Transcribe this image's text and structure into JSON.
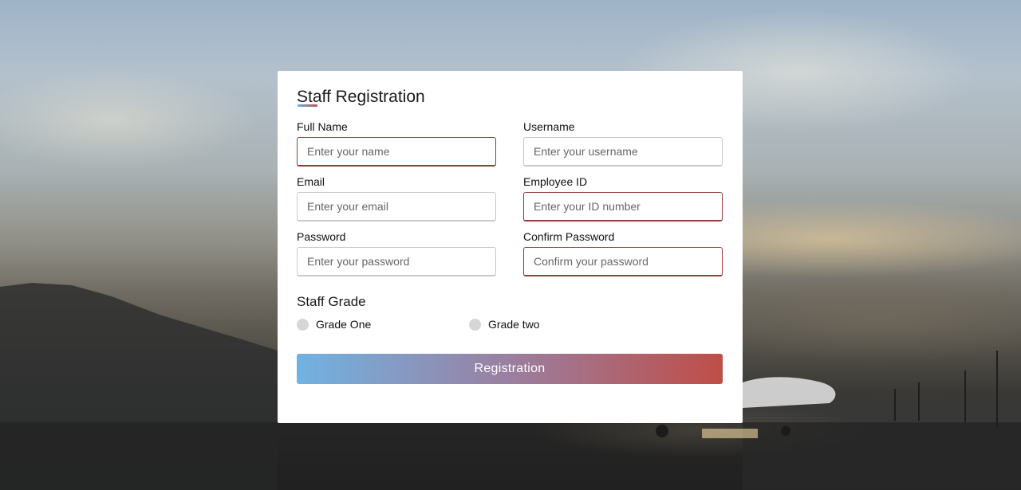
{
  "form": {
    "title": "Staff Registration",
    "fields": {
      "full_name": {
        "label": "Full Name",
        "placeholder": "Enter your name",
        "value": ""
      },
      "username": {
        "label": "Username",
        "placeholder": "Enter your username",
        "value": ""
      },
      "email": {
        "label": "Email",
        "placeholder": "Enter your email",
        "value": ""
      },
      "employee_id": {
        "label": "Employee ID",
        "placeholder": "Enter your ID number",
        "value": ""
      },
      "password": {
        "label": "Password",
        "placeholder": "Enter your password",
        "value": ""
      },
      "confirm_password": {
        "label": "Confirm Password",
        "placeholder": "Confirm your password",
        "value": ""
      }
    },
    "grade": {
      "title": "Staff Grade",
      "options": [
        {
          "label": "Grade One",
          "selected": false
        },
        {
          "label": "Grade two",
          "selected": false
        }
      ]
    },
    "submit_label": "Registration"
  },
  "colors": {
    "invalid_border": "#9b3a3a",
    "button_gradient_start": "#71b3e3",
    "button_gradient_end": "#c04d47",
    "card_background": "#ffffff"
  }
}
